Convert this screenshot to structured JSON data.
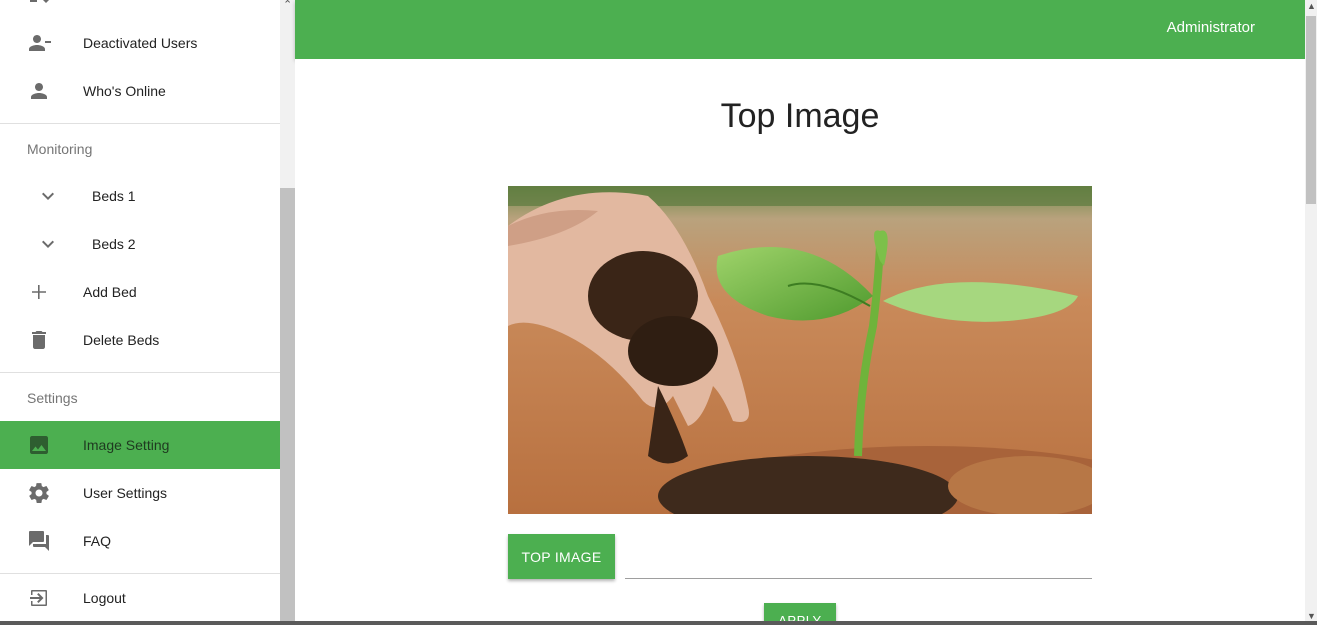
{
  "sidebar": {
    "items_top": [
      {
        "label": "Deactivated Users",
        "icon": "person-remove-icon"
      },
      {
        "label": "Who's Online",
        "icon": "person-icon"
      }
    ],
    "monitoring_header": "Monitoring",
    "monitoring_items": [
      {
        "label": "Beds 1",
        "icon": "chevron-down-icon"
      },
      {
        "label": "Beds 2",
        "icon": "chevron-down-icon"
      },
      {
        "label": "Add Bed",
        "icon": "plus-icon"
      },
      {
        "label": "Delete Beds",
        "icon": "trash-icon"
      }
    ],
    "settings_header": "Settings",
    "settings_items": [
      {
        "label": "Image Setting",
        "icon": "image-icon",
        "active": true
      },
      {
        "label": "User Settings",
        "icon": "gear-icon"
      },
      {
        "label": "FAQ",
        "icon": "chat-icon"
      }
    ],
    "logout_label": "Logout"
  },
  "appbar": {
    "user": "Administrator",
    "color": "#4caf50"
  },
  "main": {
    "title": "Top Image",
    "upload_button": "TOP IMAGE",
    "file_value": "",
    "apply_button": "APPLY"
  },
  "colors": {
    "accent": "#4caf50",
    "text": "#222222",
    "muted": "#757575"
  }
}
